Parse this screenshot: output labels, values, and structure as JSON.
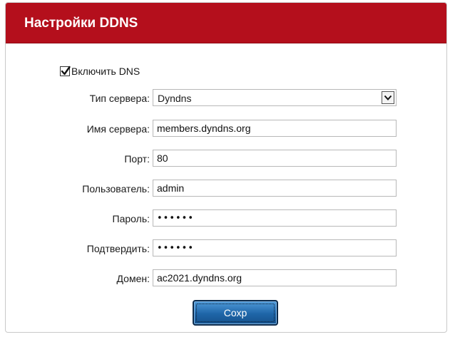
{
  "panel": {
    "title": "Настройки DDNS"
  },
  "enable_dns": {
    "label": "Включить DNS",
    "checked": true
  },
  "form": {
    "server_type": {
      "label": "Тип сервера:",
      "value": "Dyndns"
    },
    "server_name": {
      "label": "Имя сервера:",
      "value": "members.dyndns.org"
    },
    "port": {
      "label": "Порт:",
      "value": "80"
    },
    "user": {
      "label": "Пользователь:",
      "value": "admin"
    },
    "password": {
      "label": "Пароль:",
      "value": "••••••"
    },
    "confirm": {
      "label": "Подтвердить:",
      "value": "••••••"
    },
    "domain": {
      "label": "Домен:",
      "value": "ac2021.dyndns.org"
    }
  },
  "save_button": {
    "label": "Сохр"
  },
  "colors": {
    "header_bg": "#b40f1c",
    "button_bg": "#1e65a8"
  },
  "icons": {
    "checkbox_mark": "checkmark-icon",
    "select_arrow": "chevron-down-icon"
  }
}
